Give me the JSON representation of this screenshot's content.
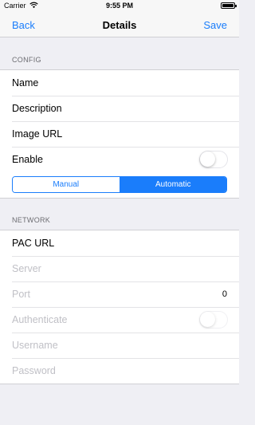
{
  "status_bar": {
    "carrier": "Carrier",
    "time": "9:55 PM",
    "battery_level": 0.95
  },
  "nav": {
    "back_label": "Back",
    "title": "Details",
    "save_label": "Save"
  },
  "config": {
    "header": "CONFIG",
    "name_label": "Name",
    "description_label": "Description",
    "image_url_label": "Image URL",
    "enable_label": "Enable",
    "enable_on": false,
    "mode_options": [
      "Manual",
      "Automatic"
    ],
    "mode_selected": "Automatic"
  },
  "network": {
    "header": "NETWORK",
    "pac_url_label": "PAC URL",
    "server_label": "Server",
    "port_label": "Port",
    "port_value": "0",
    "authenticate_label": "Authenticate",
    "authenticate_on": false,
    "username_label": "Username",
    "password_label": "Password"
  },
  "colors": {
    "accent": "#1a7dfb",
    "background": "#efeff4"
  }
}
